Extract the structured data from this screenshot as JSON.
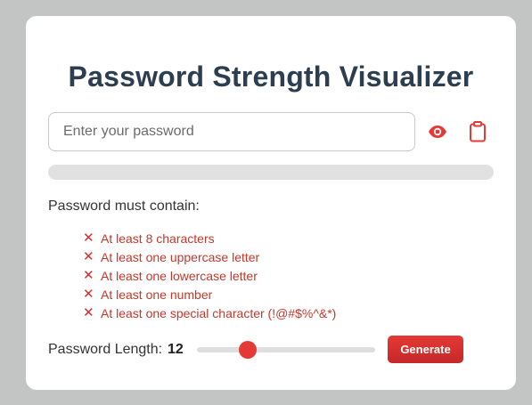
{
  "header": {
    "title": "Password Strength Visualizer"
  },
  "password_input": {
    "value": "",
    "placeholder": "Enter your password"
  },
  "icons": {
    "toggle_visibility": "eye-icon",
    "copy": "clipboard-icon"
  },
  "colors": {
    "accent": "#e53935",
    "title": "#2c3e50",
    "requirement_unmet": "#c0392b"
  },
  "strength": {
    "percent": 0
  },
  "requirements": {
    "heading": "Password must contain:",
    "items": [
      {
        "mark": "✕",
        "label": "At least 8 characters",
        "met": false
      },
      {
        "mark": "✕",
        "label": "At least one uppercase letter",
        "met": false
      },
      {
        "mark": "✕",
        "label": "At least one lowercase letter",
        "met": false
      },
      {
        "mark": "✕",
        "label": "At least one number",
        "met": false
      },
      {
        "mark": "✕",
        "label": "At least one special character (!@#$%^&*)",
        "met": false
      }
    ]
  },
  "length_control": {
    "label": "Password Length:",
    "value": "12",
    "min": 4,
    "max": 32,
    "slider_value": 12
  },
  "generate_button": {
    "label": "Generate"
  }
}
